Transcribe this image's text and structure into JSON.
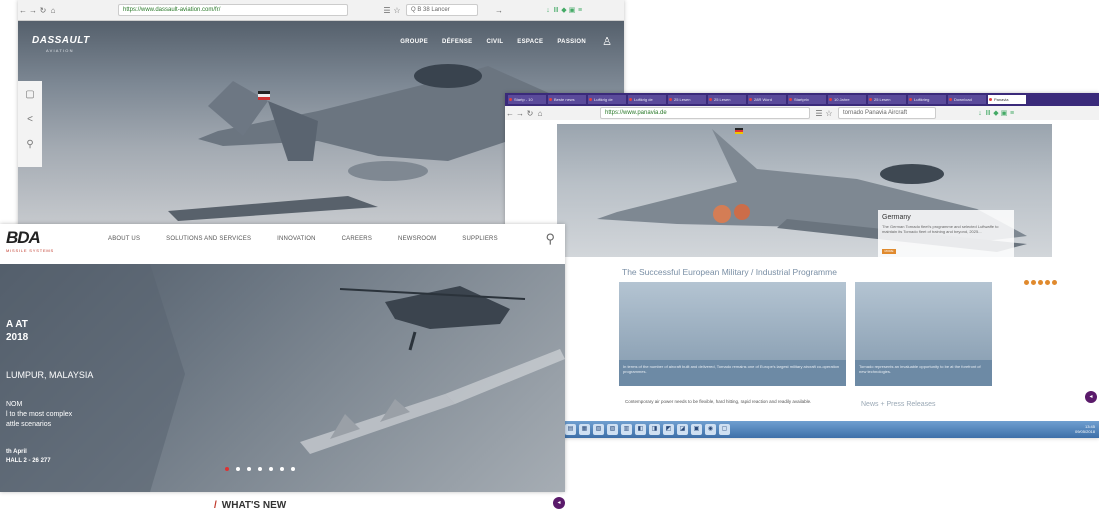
{
  "dassault": {
    "url": "https://www.dassault-aviation.com/fr/",
    "search": "Q B 38 Lancer",
    "brand": "DASSAULT",
    "brand_sub": "AVIATION",
    "nav": [
      "GROUPE",
      "DÉFENSE",
      "CIVIL",
      "ESPACE",
      "PASSION"
    ],
    "user_icon": "user-icon",
    "side_icons": [
      "camera-icon",
      "share-icon",
      "wrench-icon"
    ]
  },
  "panavia": {
    "tabs": [
      "Startp - 10",
      "Beste news",
      "Luftkrig de",
      "Luftkrig de",
      "25 Lesen",
      "25 Lesen",
      "28R Word",
      "Startprix",
      "10 Jahre",
      "25 Lesen",
      "Luftkrieg",
      "Download",
      "Panavia"
    ],
    "url": "https://www.panavia.de",
    "search": "tornado Panavia Aircraft",
    "callout_title": "Germany",
    "callout_body": "The German Tornado fleet's programme and selected Luftwaffe to maintain its Tornado fleet of training and beyond, 2025...",
    "callout_more": "MORE",
    "section_title": "The Successful European Military / Industrial Programme",
    "card1_caption": "In terms of the number of aircraft built and delivered, Tornado remains one of Europe's largest military aircraft co-operation programmes.",
    "card2_caption": "Tornado represents an invaluable opportunity to be at the forefront of new technologies.",
    "body_text": "Contemporary air power needs to be flexible, hard hitting, rapid reaction and readily available.",
    "news": "News + Press Releases",
    "tray_time": "13:45",
    "tray_date": "09/05/2018"
  },
  "mbda": {
    "logo": "BDA",
    "tagline": "MISSILE SYSTEMS",
    "nav": [
      "ABOUT US",
      "SOLUTIONS AND SERVICES",
      "INNOVATION",
      "CAREERS",
      "NEWSROOM",
      "SUPPLIERS"
    ],
    "hero_title_1": "A AT",
    "hero_title_2": "2018",
    "hero_location": "LUMPUR, MALAYSIA",
    "hero_desc_1": "NOM",
    "hero_desc_2": "l to the most complex",
    "hero_desc_3": "attle scenarios",
    "hero_date_1": "th April",
    "hero_date_2": "HALL 2 - 26 277",
    "whats_new": "WHAT'S NEW",
    "slide_count": 7,
    "active_slide": 1
  },
  "colors": {
    "panavia_tabbar": "#3a2a7a",
    "mbda_accent": "#c0392b",
    "panavia_orange": "#e08a2e",
    "taskbar": "#3d6fa8"
  }
}
